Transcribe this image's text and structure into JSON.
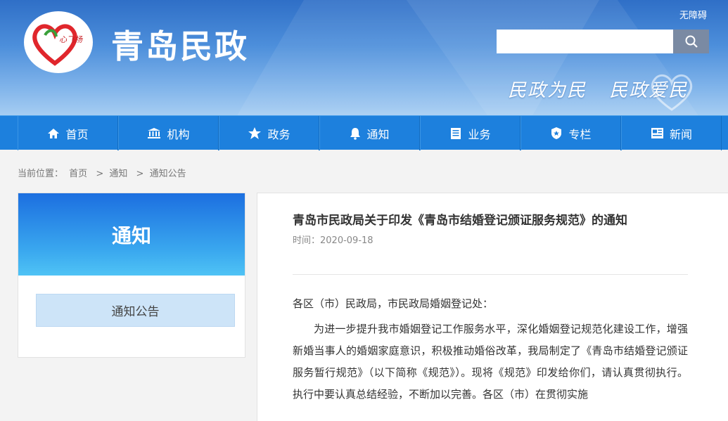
{
  "header": {
    "title": "青岛民政",
    "accessibility_link": "无障碍",
    "search": {
      "placeholder": "",
      "value": ""
    },
    "slogan": [
      "民政为民",
      "民政爱民"
    ],
    "logo_text": "心飞扬",
    "brand_color": "#1d80dd"
  },
  "nav": {
    "items": [
      {
        "label": "首页",
        "icon": "home-icon"
      },
      {
        "label": "机构",
        "icon": "building-icon"
      },
      {
        "label": "政务",
        "icon": "star-icon"
      },
      {
        "label": "通知",
        "icon": "bell-icon"
      },
      {
        "label": "业务",
        "icon": "book-icon"
      },
      {
        "label": "专栏",
        "icon": "badge-icon"
      },
      {
        "label": "新闻",
        "icon": "newspaper-icon"
      }
    ]
  },
  "breadcrumb": {
    "prefix": "当前位置：",
    "items": [
      "首页",
      "通知",
      "通知公告"
    ],
    "separator": ">"
  },
  "sidebar": {
    "heading": "通知",
    "items": [
      "通知公告"
    ]
  },
  "article": {
    "title": "青岛市民政局关于印发《青岛市结婚登记颁证服务规范》的通知",
    "time_label": "时间：",
    "time": "2020-09-18",
    "salutation": "各区（市）民政局，市民政局婚姻登记处：",
    "paragraph": "为进一步提升我市婚姻登记工作服务水平，深化婚姻登记规范化建设工作，增强新婚当事人的婚姻家庭意识，积极推动婚俗改革，我局制定了《青岛市结婚登记颁证服务暂行规范》（以下简称《规范》）。现将《规范》印发给你们，请认真贯彻执行。执行中要认真总结经验，不断加以完善。各区（市）在贯彻实施"
  }
}
